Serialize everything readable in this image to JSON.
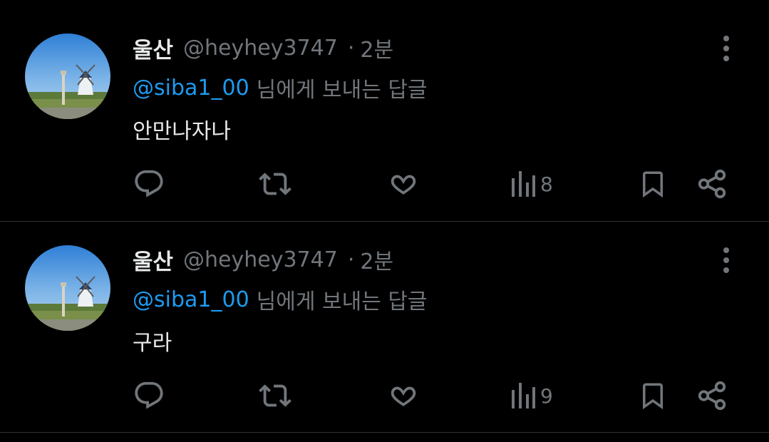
{
  "tweets": [
    {
      "name": "울산",
      "handle": "@heyhey3747",
      "separator": "·",
      "time": "2분",
      "mention": "@siba1_00",
      "reply_suffix": "님에게 보내는 답글",
      "text": "안만나자나",
      "views": "8"
    },
    {
      "name": "울산",
      "handle": "@heyhey3747",
      "separator": "·",
      "time": "2분",
      "mention": "@siba1_00",
      "reply_suffix": "님에게 보내는 답글",
      "text": "구라",
      "views": "9"
    }
  ],
  "colors": {
    "background": "#000000",
    "primary_text": "#e7e9ea",
    "secondary_text": "#71767b",
    "mention": "#1d9bf0",
    "divider": "#2f3336"
  },
  "icons": [
    "reply-icon",
    "retweet-icon",
    "like-icon",
    "views-icon",
    "bookmark-icon",
    "share-icon",
    "more-icon"
  ]
}
